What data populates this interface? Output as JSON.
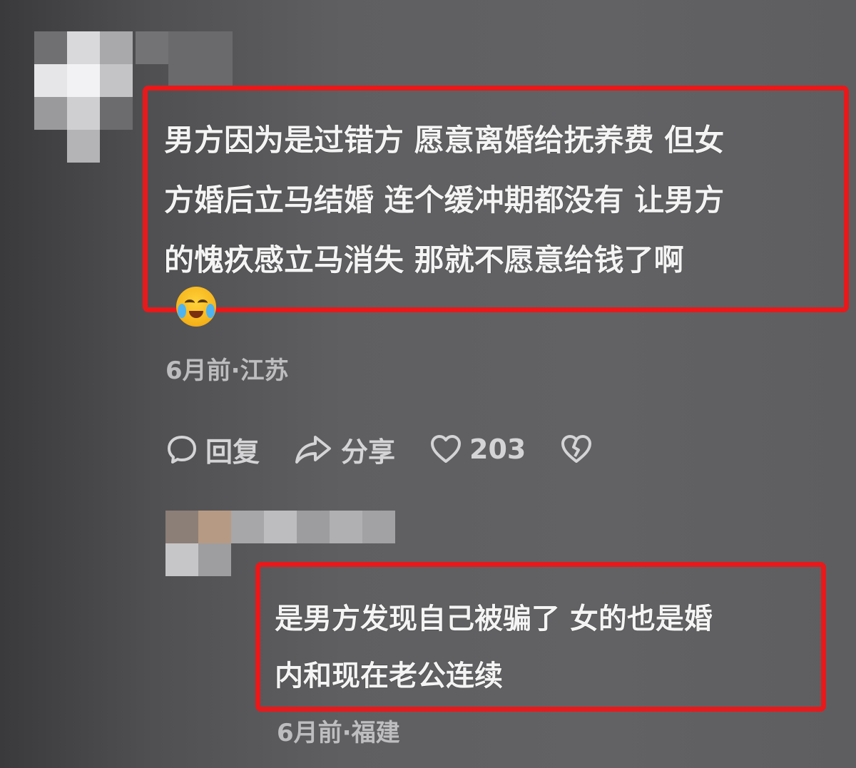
{
  "comments": [
    {
      "text_lines": [
        "男方因为是过错方 愿意离婚给抚养费 但女",
        "方婚后立马结婚 连个缓冲期都没有 让男方",
        "的愧疚感立马消失 那就不愿意给钱了啊"
      ],
      "emoji": "crying-laughing-emoji",
      "meta": "6月前·江苏",
      "actions": {
        "reply_label": "回复",
        "share_label": "分享",
        "like_count": "203"
      }
    },
    {
      "text_lines": [
        "是男方发现自己被骗了 女的也是婚",
        "内和现在老公连续"
      ],
      "meta": "6月前·福建"
    }
  ],
  "colors": {
    "highlight_border": "#e8191b",
    "text": "#f4f4f4",
    "meta_text": "#cfcfd1"
  }
}
